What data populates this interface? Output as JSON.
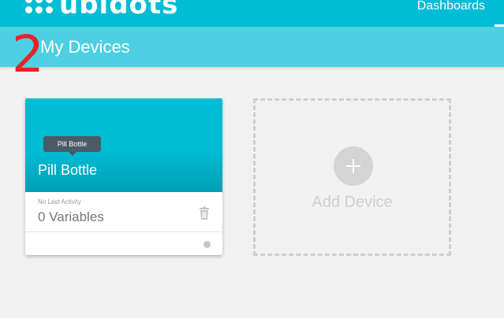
{
  "header": {
    "brand": "ubidots",
    "nav_dashboards": "Dashboards"
  },
  "subheader": {
    "title": "My Devices"
  },
  "annotation": {
    "step_number": "2"
  },
  "devices": [
    {
      "tooltip": "Pill Bottle",
      "name": "Pill Bottle",
      "last_activity": "No Last Activity",
      "variables": "0 Variables"
    }
  ],
  "add_device": {
    "label": "Add Device"
  },
  "icons": {
    "logo": "dots-grid-icon",
    "delete": "trash-icon",
    "add": "plus-icon",
    "status": "status-dot-icon"
  },
  "colors": {
    "primary": "#00bcd4",
    "subheader": "#4dd0e1",
    "background": "#f2f2f2",
    "annotation": "#e8212a"
  }
}
